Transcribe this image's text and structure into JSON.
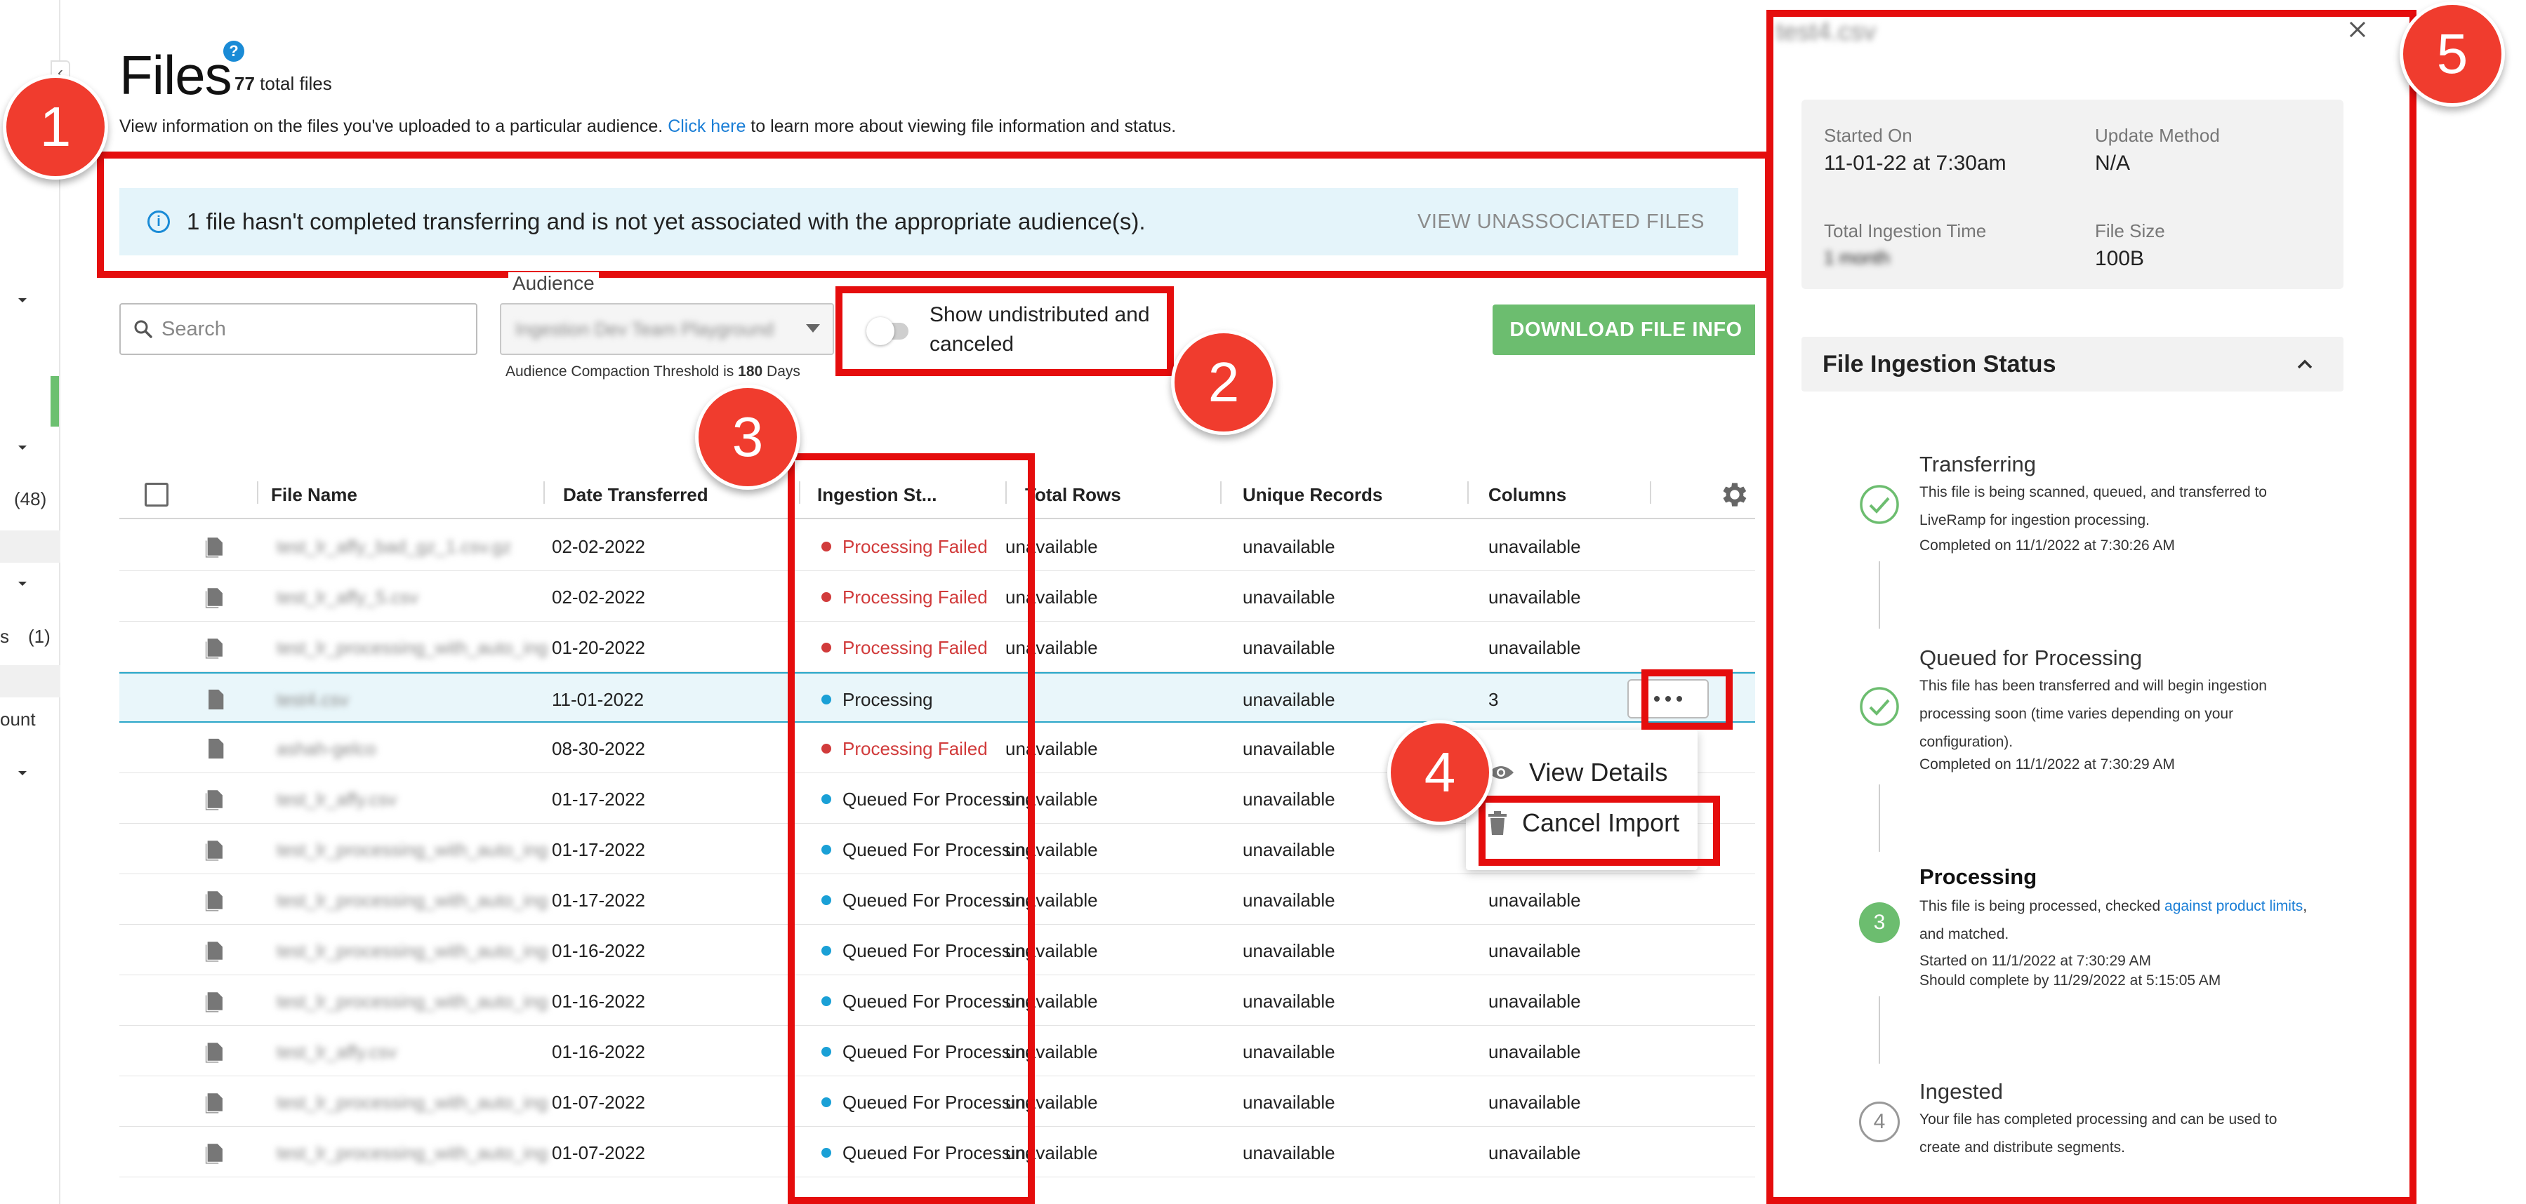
{
  "nav": {
    "counts": [
      "(48)",
      "(1)"
    ],
    "partial_text": [
      "s",
      "ount"
    ]
  },
  "header": {
    "title": "Files",
    "help": "?",
    "total_count": "77",
    "total_suffix": " total files",
    "subtitle_prefix": "View information on the files you've uploaded to a particular audience. ",
    "subtitle_link": "Click here",
    "subtitle_suffix": " to learn more about viewing file information and status."
  },
  "banner": {
    "message": "1 file hasn't completed transferring and is not yet associated with the appropriate audience(s).",
    "action": "VIEW UNASSOCIATED FILES"
  },
  "toolbar": {
    "search_placeholder": "Search",
    "audience_label": "Audience",
    "audience_value": "Ingestion Dev Team Playground",
    "threshold_prefix": "Audience Compaction Threshold is ",
    "threshold_value": "180",
    "threshold_suffix": " Days",
    "toggle_label": "Show undistributed and canceled",
    "toggle_on": false,
    "download_label": "DOWNLOAD FILE INFO"
  },
  "table": {
    "columns": [
      "File Name",
      "Date Transferred",
      "Ingestion St...",
      "Total Rows",
      "Unique Records",
      "Columns"
    ],
    "rows": [
      {
        "name": "test_lr_affy_bad_gz_1.csv.gz",
        "date": "02-02-2022",
        "status": "Processing Failed",
        "total": "unavailable",
        "unique": "unavailable",
        "columns": "unavailable"
      },
      {
        "name": "test_lr_affy_5.csv",
        "date": "02-02-2022",
        "status": "Processing Failed",
        "total": "unavailable",
        "unique": "unavailable",
        "columns": "unavailable"
      },
      {
        "name": "test_lr_processing_with_auto_ing",
        "date": "01-20-2022",
        "status": "Processing Failed",
        "total": "unavailable",
        "unique": "unavailable",
        "columns": "unavailable"
      },
      {
        "name": "test4.csv",
        "date": "11-01-2022",
        "status": "Processing",
        "total": "",
        "unique": "unavailable",
        "columns": "3"
      },
      {
        "name": "ashah-gelco",
        "date": "08-30-2022",
        "status": "Processing Failed",
        "total": "unavailable",
        "unique": "unavailable",
        "columns": "unavailable"
      },
      {
        "name": "test_lr_affy.csv",
        "date": "01-17-2022",
        "status": "Queued For Processing",
        "total": "unavailable",
        "unique": "unavailable",
        "columns": "unavailable"
      },
      {
        "name": "test_lr_processing_with_auto_ing",
        "date": "01-17-2022",
        "status": "Queued For Processing",
        "total": "unavailable",
        "unique": "unavailable",
        "columns": "unavailable"
      },
      {
        "name": "test_lr_processing_with_auto_ing",
        "date": "01-17-2022",
        "status": "Queued For Processing",
        "total": "unavailable",
        "unique": "unavailable",
        "columns": "unavailable"
      },
      {
        "name": "test_lr_processing_with_auto_ing",
        "date": "01-16-2022",
        "status": "Queued For Processing",
        "total": "unavailable",
        "unique": "unavailable",
        "columns": "unavailable"
      },
      {
        "name": "test_lr_processing_with_auto_ing",
        "date": "01-16-2022",
        "status": "Queued For Processing",
        "total": "unavailable",
        "unique": "unavailable",
        "columns": "unavailable"
      },
      {
        "name": "test_lr_affy.csv",
        "date": "01-16-2022",
        "status": "Queued For Processing",
        "total": "unavailable",
        "unique": "unavailable",
        "columns": "unavailable"
      },
      {
        "name": "test_lr_processing_with_auto_ing",
        "date": "01-07-2022",
        "status": "Queued For Processing",
        "total": "unavailable",
        "unique": "unavailable",
        "columns": "unavailable"
      },
      {
        "name": "test_lr_processing_with_auto_ing",
        "date": "01-07-2022",
        "status": "Queued For Processing",
        "total": "unavailable",
        "unique": "unavailable",
        "columns": "unavailable"
      }
    ]
  },
  "context_menu": {
    "view_details": "View Details",
    "cancel_import": "Cancel Import"
  },
  "panel": {
    "title": "test4.csv",
    "started_on_label": "Started On",
    "started_on_value": "11-01-22 at 7:30am",
    "update_method_label": "Update Method",
    "update_method_value": "N/A",
    "ingestion_time_label": "Total Ingestion Time",
    "ingestion_time_value": "1 month",
    "file_size_label": "File Size",
    "file_size_value": "100B",
    "status_section_title": "File Ingestion Status",
    "steps": [
      {
        "title": "Transferring",
        "desc": "This file is being scanned, queued, and transferred to LiveRamp for ingestion processing.",
        "extra": "Completed on 11/1/2022 at 7:30:26 AM"
      },
      {
        "title": "Queued for Processing",
        "desc": "This file has been transferred and will begin ingestion processing soon (time varies depending on your configuration).",
        "extra": "Completed on 11/1/2022 at 7:30:29 AM"
      },
      {
        "title": "Processing",
        "num": "3",
        "desc_prefix": "This file is being processed, checked ",
        "desc_link": "against product limits",
        "desc_suffix": ", and matched.",
        "extra1": "Started on 11/1/2022 at 7:30:29 AM",
        "extra2": "Should complete by 11/29/2022 at 5:15:05 AM"
      },
      {
        "title": "Ingested",
        "num": "4",
        "desc": "Your file has completed processing and can be used to create and distribute segments."
      }
    ]
  },
  "annotations": [
    "1",
    "2",
    "3",
    "4",
    "5"
  ],
  "colors": {
    "fail": "#d13b3b",
    "processing_dot": "#1aa0d6",
    "success_green": "#6cbd6f",
    "link": "#1a7ed6",
    "annotation_red": "#e50d0d"
  }
}
